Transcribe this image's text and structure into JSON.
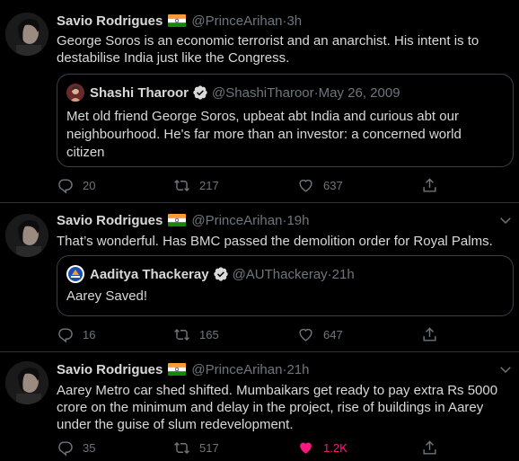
{
  "tweets": [
    {
      "author": "Savio Rodrigues",
      "handle": "@PrinceArihan",
      "time": "3h",
      "text": "George Soros is an economic terrorist and an anarchist. His intent is to destabilise India just like the Congress.",
      "quote": {
        "author": "Shashi Tharoor",
        "handle": "@ShashiTharoor",
        "time": "May 26, 2009",
        "text": "Met old friend George Soros, upbeat abt India and curious abt our neighbourhood. He's far more than an investor: a concerned world citizen"
      },
      "replies": "20",
      "retweets": "217",
      "likes": "637"
    },
    {
      "author": "Savio Rodrigues",
      "handle": "@PrinceArihan",
      "time": "19h",
      "text": "That’s wonderful. Has BMC passed the demolition order for Royal Palms.",
      "quote": {
        "author": "Aaditya Thackeray",
        "handle": "@AUThackeray",
        "time": "21h",
        "text": "Aarey Saved!"
      },
      "replies": "16",
      "retweets": "165",
      "likes": "647"
    },
    {
      "author": "Savio Rodrigues",
      "handle": "@PrinceArihan",
      "time": "21h",
      "text": "Aarey Metro car shed shifted. Mumbaikars get ready to pay extra Rs 5000 crore on the minimum and delay in the project, rise of buildings in Aarey under the guise of slum redevelopment.",
      "replies": "35",
      "retweets": "517",
      "likes": "1.2K"
    }
  ],
  "separator": " · ",
  "icons": {
    "reply": "reply-icon",
    "retweet": "retweet-icon",
    "like": "heart-icon",
    "share": "share-icon",
    "more": "chevron-down-icon",
    "verified": "verified-badge-icon",
    "flag": "india-flag-icon"
  },
  "colors": {
    "background": "#000000",
    "text": "#d9d9d9",
    "muted": "#6e767d",
    "liked": "#f91880",
    "verified": "#d9d9d9"
  }
}
